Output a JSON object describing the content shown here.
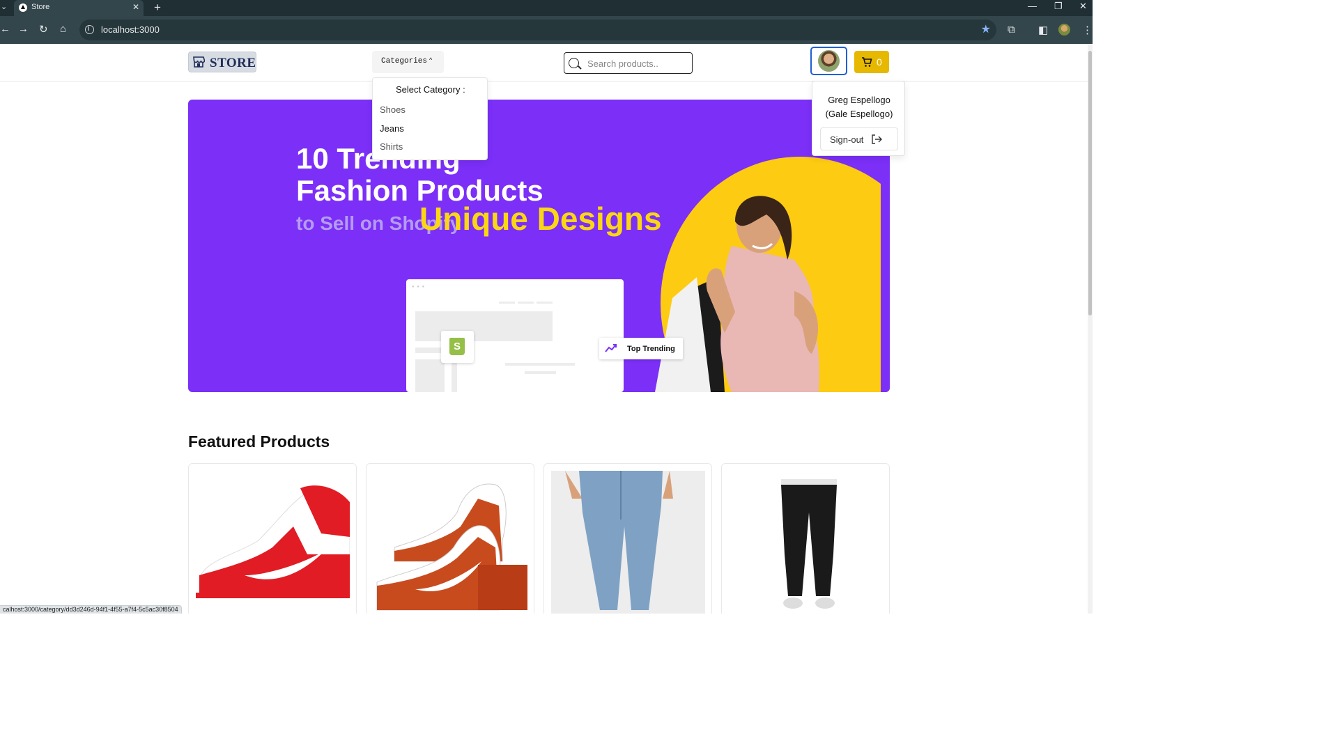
{
  "browser": {
    "tab_title": "Store",
    "url": "localhost:3000",
    "status_url": "calhost:3000/category/dd3d246d-94f1-4f55-a7f4-5c5ac30f8504"
  },
  "header": {
    "logo_text": "STORE",
    "categories_label": "Categories",
    "search_placeholder": "Search products..",
    "cart_count": "0"
  },
  "categories_menu": {
    "title": "Select Category :",
    "items": [
      "Shoes",
      "Jeans",
      "Shirts"
    ],
    "hovered_item": "Jeans"
  },
  "user_menu": {
    "name_line1": "Greg Espellogo",
    "name_line2": "(Gale Espellogo)",
    "signout_label": "Sign-out"
  },
  "hero": {
    "heading_line1": "10 Trending",
    "heading_line2": "Fashion Products",
    "subheading": "to Sell on Shopify",
    "accent": "Unique Designs",
    "badge_label": "Top Trending",
    "bg_color": "#7b2ff7",
    "accent_color": "#fbd713"
  },
  "featured": {
    "title": "Featured Products",
    "products": [
      {
        "image": "red-white-sneaker"
      },
      {
        "image": "orange-white-sneakers"
      },
      {
        "image": "light-blue-jeans"
      },
      {
        "image": "black-jeans"
      }
    ]
  },
  "colors": {
    "cart_button": "#e6b800",
    "avatar_border": "#1f5fd6"
  }
}
